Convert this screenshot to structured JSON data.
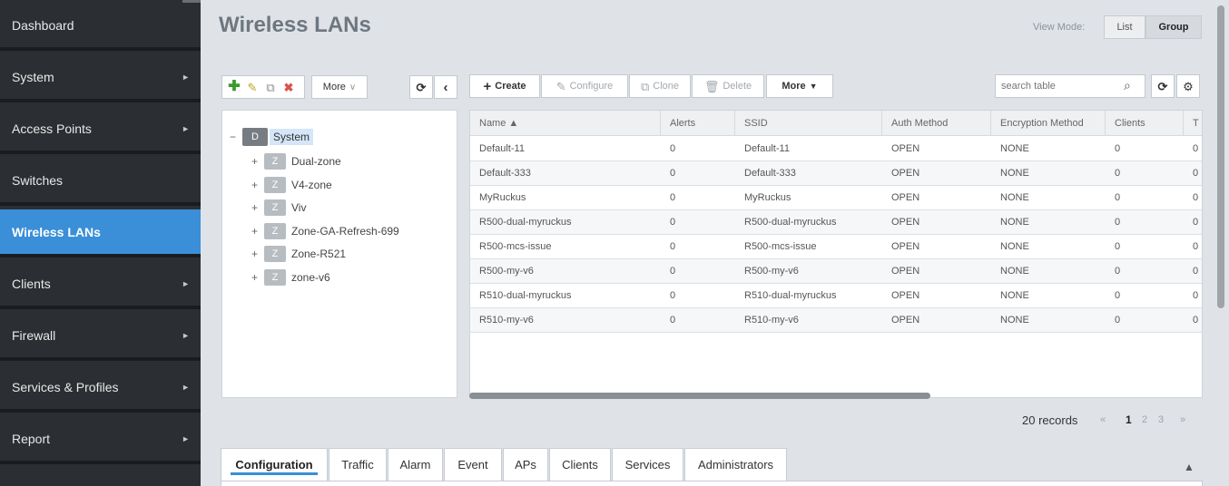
{
  "sidebar": {
    "items": [
      {
        "label": "Dashboard",
        "has_arrow": false,
        "active": false
      },
      {
        "label": "System",
        "has_arrow": true,
        "active": false
      },
      {
        "label": "Access Points",
        "has_arrow": true,
        "active": false
      },
      {
        "label": "Switches",
        "has_arrow": false,
        "active": false
      },
      {
        "label": "Wireless LANs",
        "has_arrow": false,
        "active": true
      },
      {
        "label": "Clients",
        "has_arrow": true,
        "active": false
      },
      {
        "label": "Firewall",
        "has_arrow": true,
        "active": false
      },
      {
        "label": "Services & Profiles",
        "has_arrow": true,
        "active": false
      },
      {
        "label": "Report",
        "has_arrow": true,
        "active": false
      }
    ],
    "arrow_glyph": "►"
  },
  "header": {
    "title": "Wireless LANs",
    "view_mode_label": "View Mode:",
    "view_mode_list": "List",
    "view_mode_group": "Group"
  },
  "tree_toolbar": {
    "more_label": "More",
    "more_chevron": "∨"
  },
  "table_toolbar": {
    "create": "Create",
    "configure": "Configure",
    "clone": "Clone",
    "delete": "Delete",
    "more": "More",
    "more_caret": "▼",
    "search_placeholder": "search table"
  },
  "tree": {
    "root_badge": "D",
    "root_label": "System",
    "zone_badge": "Z",
    "expand_glyph": "+",
    "collapse_glyph": "−",
    "zones": [
      "Dual-zone",
      "V4-zone",
      "Viv",
      "Zone-GA-Refresh-699",
      "Zone-R521",
      "zone-v6"
    ]
  },
  "table": {
    "columns": [
      "Name ▲",
      "Alerts",
      "SSID",
      "Auth Method",
      "Encryption Method",
      "Clients",
      "T"
    ],
    "rows": [
      [
        "Default-11",
        "0",
        "Default-11",
        "OPEN",
        "NONE",
        "0",
        "0"
      ],
      [
        "Default-333",
        "0",
        "Default-333",
        "OPEN",
        "NONE",
        "0",
        "0"
      ],
      [
        "MyRuckus",
        "0",
        "MyRuckus",
        "OPEN",
        "NONE",
        "0",
        "0"
      ],
      [
        "R500-dual-myruckus",
        "0",
        "R500-dual-myruckus",
        "OPEN",
        "NONE",
        "0",
        "0"
      ],
      [
        "R500-mcs-issue",
        "0",
        "R500-mcs-issue",
        "OPEN",
        "NONE",
        "0",
        "0"
      ],
      [
        "R500-my-v6",
        "0",
        "R500-my-v6",
        "OPEN",
        "NONE",
        "0",
        "0"
      ],
      [
        "R510-dual-myruckus",
        "0",
        "R510-dual-myruckus",
        "OPEN",
        "NONE",
        "0",
        "0"
      ],
      [
        "R510-my-v6",
        "0",
        "R510-my-v6",
        "OPEN",
        "NONE",
        "0",
        "0"
      ]
    ]
  },
  "pagination": {
    "records": "20 records",
    "prev": "«",
    "pages": [
      "1",
      "2",
      "3"
    ],
    "current": "1",
    "next": "»"
  },
  "bottom_tabs": {
    "items": [
      "Configuration",
      "Traffic",
      "Alarm",
      "Event",
      "APs",
      "Clients",
      "Services",
      "Administrators"
    ],
    "active": "Configuration",
    "collapse_glyph": "▲"
  },
  "colors": {
    "sidebar_bg": "#2b2f33",
    "active_accent": "#3a8fd8",
    "page_bg": "#dfe3e8",
    "add_green": "#3a9a2e",
    "delete_red": "#d9534f"
  }
}
